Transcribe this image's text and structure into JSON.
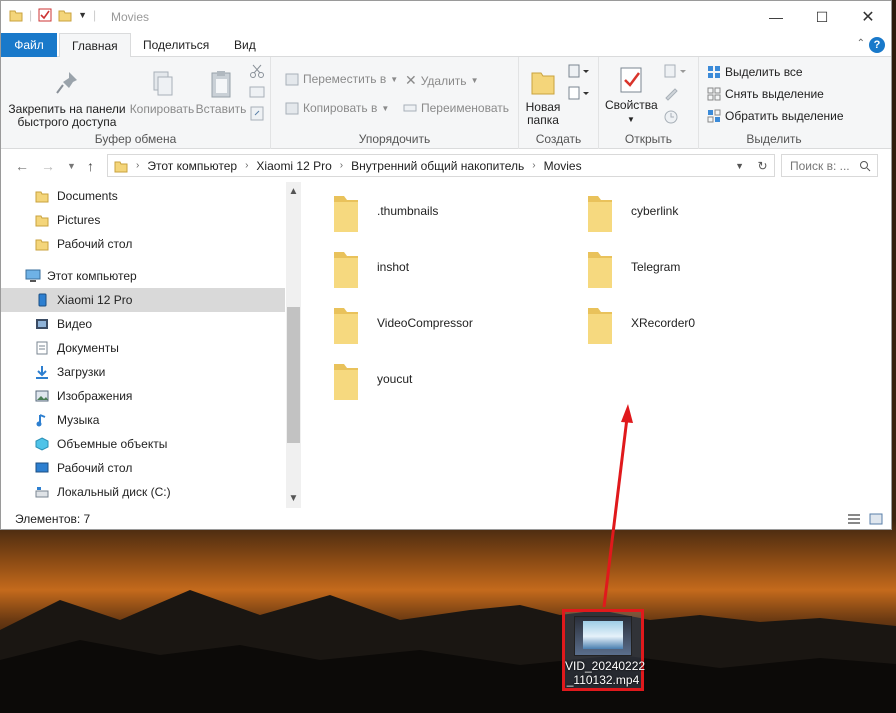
{
  "window": {
    "title": "Movies",
    "tabs": {
      "file": "Файл",
      "home": "Главная",
      "share": "Поделиться",
      "view": "Вид"
    }
  },
  "ribbon": {
    "clipboard": {
      "label": "Буфер обмена",
      "pin": "Закрепить на панели быстрого доступа",
      "pin_line1": "Закрепить на панели",
      "pin_line2": "быстрого доступа",
      "copy": "Копировать",
      "paste": "Вставить"
    },
    "organize": {
      "label": "Упорядочить",
      "move_to": "Переместить в",
      "copy_to": "Копировать в",
      "delete": "Удалить",
      "rename": "Переименовать"
    },
    "create": {
      "label": "Создать",
      "new_folder_line1": "Новая",
      "new_folder_line2": "папка"
    },
    "open": {
      "label": "Открыть",
      "properties": "Свойства"
    },
    "select": {
      "label": "Выделить",
      "select_all": "Выделить все",
      "select_none": "Снять выделение",
      "invert": "Обратить выделение"
    }
  },
  "address": {
    "crumbs": [
      "Этот компьютер",
      "Xiaomi 12 Pro",
      "Внутренний общий накопитель",
      "Movies"
    ],
    "search_placeholder": "Поиск в: ..."
  },
  "nav": {
    "items": [
      {
        "label": "Documents",
        "icon": "folder-icon"
      },
      {
        "label": "Pictures",
        "icon": "folder-icon"
      },
      {
        "label": "Рабочий стол",
        "icon": "folder-icon"
      },
      {
        "label": "Этот компьютер",
        "icon": "computer-icon"
      },
      {
        "label": "Xiaomi 12 Pro",
        "icon": "phone-icon",
        "selected": true
      },
      {
        "label": "Видео",
        "icon": "video-icon"
      },
      {
        "label": "Документы",
        "icon": "document-icon"
      },
      {
        "label": "Загрузки",
        "icon": "download-icon"
      },
      {
        "label": "Изображения",
        "icon": "image-icon"
      },
      {
        "label": "Музыка",
        "icon": "music-icon"
      },
      {
        "label": "Объемные объекты",
        "icon": "3d-objects-icon"
      },
      {
        "label": "Рабочий стол",
        "icon": "desktop-icon"
      },
      {
        "label": "Локальный диск (C:)",
        "icon": "drive-icon"
      }
    ]
  },
  "folders": [
    ".thumbnails",
    "cyberlink",
    "inshot",
    "Telegram",
    "VideoCompressor",
    "XRecorder0",
    "youcut"
  ],
  "status": {
    "items_count": "Элементов: 7"
  },
  "desktop_file": {
    "name_line1": "VID_20240222",
    "name_line2": "_110132.mp4"
  },
  "colors": {
    "accent": "#1979ca",
    "highlight": "#e0191c",
    "folder": "#f4d57a"
  }
}
